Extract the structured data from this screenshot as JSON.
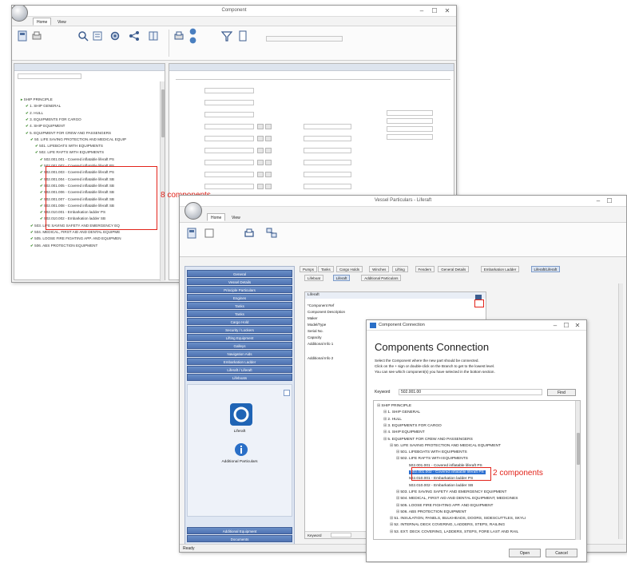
{
  "win1": {
    "title": "Component",
    "ribbon_tabs": [
      "Home",
      "View"
    ],
    "tree_items": [
      "SHIP PRINCIPLE",
      "1. SHIP GENERAL",
      "2. HULL",
      "3. EQUIPMENTS FOR CARGO",
      "4. SHIP EQUIPMENT",
      "5. EQUIPMENT FOR CREW AND PASSENGERS",
      "50. LIFE SAVING PROTECTION AND MEDICAL EQUIP",
      "501. LIFEBOATS WITH EQUIPMENTS",
      "502. LIFE RAFTS WITH EQUIPMENTS",
      "502.001.001 - Covered inflatable liferaft PS",
      "502.001.002 - Covered inflatable liferaft PS",
      "502.001.003 - Covered inflatable liferaft PS",
      "502.001.004 - Covered inflatable liferaft SB",
      "502.001.005 - Covered inflatable liferaft SB",
      "502.001.006 - Covered inflatable liferaft SB",
      "502.001.007 - Covered inflatable liferaft SB",
      "502.001.008 - Covered inflatable liferaft SB",
      "502.010.001 - Embarkation ladder PS",
      "502.010.002 - Embarkation ladder SB",
      "503. LIFE SAVING SAFETY AND EMERGENCY EQ",
      "504. MEDICAL, FIRST AID AND DENTAL EQUIPME",
      "505. LOOSE FIRE FIGHTING APP. AND EQUIPMEN",
      "506. ABS PROTECTION EQUIPMENT"
    ],
    "annotation": "8  components"
  },
  "win2": {
    "title": "Vessel Particulars - Liferaft",
    "ribbon_tabs": [
      "Home",
      "View"
    ],
    "status": "Ready",
    "nav_items": [
      "General",
      "Vessel Details",
      "Principle Particulars",
      "Engines",
      "Tanks",
      "Tanks",
      "Cargo Hold",
      "Security / Lockers",
      "Lifting Equipment",
      "Galleys",
      "Navigation Aids",
      "Embarkation Ladder",
      "Liferaft / Liferaft",
      "Lifeboats"
    ],
    "nav_bottom": [
      "Additional Equipment",
      "Documents"
    ],
    "nav_icon_labels": [
      "Liferaft",
      "Additional Particulars"
    ],
    "top_tabs": [
      "Pumps",
      "Tanks",
      "Cargo Holds",
      "Winches",
      "Lifting",
      "Fenders",
      "General Details",
      "Embarkation Ladder",
      "Liferaft/Liferaft"
    ],
    "sub_tabs": [
      "Lifeboat",
      "Liferaft",
      "Additional Particulars"
    ],
    "grid_header": "Liferaft",
    "grid_rows": [
      "*Component Ref",
      "Component Description",
      "Maker",
      "Model/Type",
      "Serial No.",
      "Capacity",
      "Additional Info 1",
      "Additional Info 2"
    ],
    "keyword_label": "Keyword"
  },
  "dialog": {
    "title": "Component Connection",
    "heading": "Components Connection",
    "instructions": [
      "Select the Component where the new part should be connected.",
      "Click on the + sign or double-click on the Branch to get to the lowest level.",
      "You can see which component(s) you have selected in the bottom section."
    ],
    "keyword_label": "Keyword",
    "keyword_value": "502.001.00",
    "find_label": "Find",
    "tree": [
      "SHIP PRINCIPLE",
      "1. SHIP GENERAL",
      "2. HULL",
      "3. EQUIPMENTS FOR CARGO",
      "4. SHIP EQUIPMENT",
      "5. EQUIPMENT FOR CREW AND PASSENGERS",
      "50. LIFE SAVING PROTECTION AND MEDICAL EQUIPMENT",
      "501. LIFEBOATS WITH EQUIPMENTS",
      "502. LIFE RAFTS WITH EQUIPMENTS",
      "502.001.001 - Covered inflatable liferaft PS",
      "502.001.002 - Covered inflatable liferaft PS",
      "502.010.001 - Embarkation ladder PS",
      "502.010.002 - Embarkation ladder SB",
      "503. LIFE SAVING SAFETY AND EMERGENCY EQUIPMENT",
      "504. MEDICAL, FIRST AID AND DENTAL EQUIPMENT, MEDICINES",
      "505. LOOSE FIRE FIGHTING APP. AND EQUIPMENT",
      "506. ABS PROTECTION EQUIPMENT",
      "51. INSULATION, PANELS, BULKHEADS, DOORS, SIDESCUTTLES, SKYLI",
      "52. INTERNAL DECK COVERING, LADDERS, STEPS, RAILING",
      "53. EXT. DECK COVERING, LADDERS, STEPS, FORE LAST AND RAIL"
    ],
    "selected_index": 10,
    "annotation": "2 components",
    "open_label": "Open",
    "cancel_label": "Cancel"
  }
}
